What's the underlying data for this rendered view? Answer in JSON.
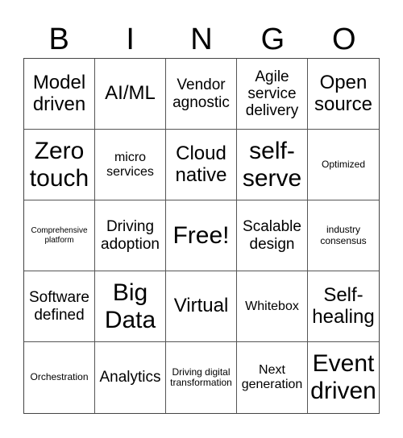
{
  "header": {
    "letters": [
      "B",
      "I",
      "N",
      "G",
      "O"
    ]
  },
  "cells": [
    {
      "text": "Model driven",
      "size": "s-xl"
    },
    {
      "text": "AI/ML",
      "size": "s-xl"
    },
    {
      "text": "Vendor agnostic",
      "size": "s-lg"
    },
    {
      "text": "Agile service delivery",
      "size": "s-lg"
    },
    {
      "text": "Open source",
      "size": "s-xl"
    },
    {
      "text": "Zero touch",
      "size": "s-xxl"
    },
    {
      "text": "micro services",
      "size": "s-md"
    },
    {
      "text": "Cloud native",
      "size": "s-xl"
    },
    {
      "text": "self-serve",
      "size": "s-xxl"
    },
    {
      "text": "Optimized",
      "size": "s-sm"
    },
    {
      "text": "Comprehensive platform",
      "size": "s-xs"
    },
    {
      "text": "Driving adoption",
      "size": "s-lg"
    },
    {
      "text": "Free!",
      "size": "s-xxl"
    },
    {
      "text": "Scalable design",
      "size": "s-lg"
    },
    {
      "text": "industry consensus",
      "size": "s-sm"
    },
    {
      "text": "Software defined",
      "size": "s-lg"
    },
    {
      "text": "Big Data",
      "size": "s-xxl"
    },
    {
      "text": "Virtual",
      "size": "s-xl"
    },
    {
      "text": "Whitebox",
      "size": "s-md"
    },
    {
      "text": "Self-healing",
      "size": "s-xl"
    },
    {
      "text": "Orchestration",
      "size": "s-sm"
    },
    {
      "text": "Analytics",
      "size": "s-lg"
    },
    {
      "text": "Driving digital transformation",
      "size": "s-sm"
    },
    {
      "text": "Next generation",
      "size": "s-md"
    },
    {
      "text": "Event driven",
      "size": "s-xxl"
    }
  ]
}
